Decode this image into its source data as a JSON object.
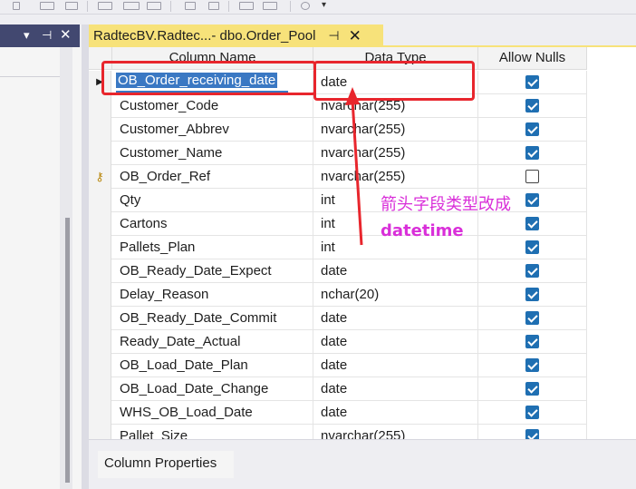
{
  "document_tab": {
    "title": "RadtecBV.Radtec...- dbo.Order_Pool",
    "pin_icon": "pin-icon",
    "close_icon": "close-icon"
  },
  "left_panel": {
    "icons": [
      "dropdown-icon",
      "pin-icon",
      "close-icon"
    ]
  },
  "grid": {
    "headers": {
      "column_name": "Column Name",
      "data_type": "Data Type",
      "allow_nulls": "Allow Nulls"
    },
    "rows": [
      {
        "name": "OB_Order_receiving_date",
        "type": "date",
        "allow_nulls": true,
        "selected": true
      },
      {
        "name": "Customer_Code",
        "type": "nvarchar(255)",
        "allow_nulls": true
      },
      {
        "name": "Customer_Abbrev",
        "type": "nvarchar(255)",
        "allow_nulls": true
      },
      {
        "name": "Customer_Name",
        "type": "nvarchar(255)",
        "allow_nulls": true
      },
      {
        "name": "OB_Order_Ref",
        "type": "nvarchar(255)",
        "allow_nulls": false,
        "primary_key": true
      },
      {
        "name": "Qty",
        "type": "int",
        "allow_nulls": true
      },
      {
        "name": "Cartons",
        "type": "int",
        "allow_nulls": true
      },
      {
        "name": "Pallets_Plan",
        "type": "int",
        "allow_nulls": true
      },
      {
        "name": "OB_Ready_Date_Expect",
        "type": "date",
        "allow_nulls": true
      },
      {
        "name": "Delay_Reason",
        "type": "nchar(20)",
        "allow_nulls": true
      },
      {
        "name": "OB_Ready_Date_Commit",
        "type": "date",
        "allow_nulls": true
      },
      {
        "name": "Ready_Date_Actual",
        "type": "date",
        "allow_nulls": true
      },
      {
        "name": "OB_Load_Date_Plan",
        "type": "date",
        "allow_nulls": true
      },
      {
        "name": "OB_Load_Date_Change",
        "type": "date",
        "allow_nulls": true
      },
      {
        "name": "WHS_OB_Load_Date",
        "type": "date",
        "allow_nulls": true
      },
      {
        "name": "Pallet_Size",
        "type": "nvarchar(255)",
        "allow_nulls": true
      }
    ]
  },
  "annotation": {
    "line1": "箭头字段类型改成",
    "line2": "datetime",
    "color": "#d92fd9",
    "box_color": "#e8262d"
  },
  "bottom": {
    "properties_tab": "Column Properties"
  },
  "colors": {
    "tab_active": "#f7e27a",
    "checkbox": "#1f6fb2",
    "selection": "#3a78c3"
  }
}
